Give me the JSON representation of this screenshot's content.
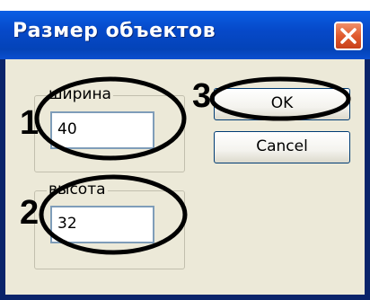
{
  "window": {
    "title": "Размер объектов",
    "close_icon": "close-icon"
  },
  "width_group": {
    "label": "ширина",
    "value": "40"
  },
  "height_group": {
    "label": "высота",
    "value": "32"
  },
  "buttons": {
    "ok_label": "OK",
    "cancel_label": "Cancel"
  },
  "annotations": {
    "marker_1": "1",
    "marker_2": "2",
    "marker_3": "3"
  },
  "colors": {
    "titlebar": "#0649c9",
    "client_bg": "#ece9d8",
    "close_button": "#e05a2e",
    "annotation": "#000000"
  }
}
